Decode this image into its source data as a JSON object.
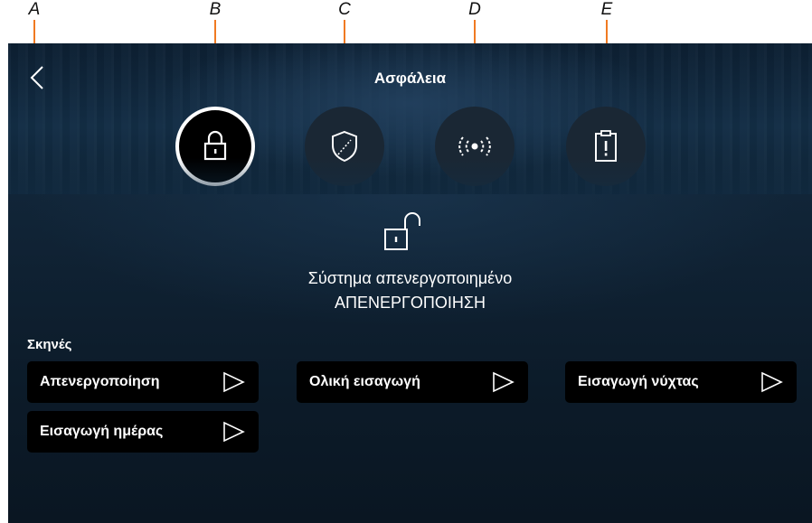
{
  "callouts": [
    "A",
    "B",
    "C",
    "D",
    "E"
  ],
  "header": {
    "title": "Ασφάλεια"
  },
  "tabs": [
    {
      "name": "lock",
      "icon": "padlock-icon",
      "active": true
    },
    {
      "name": "zones",
      "icon": "shield-icon",
      "active": false
    },
    {
      "name": "sensors",
      "icon": "signal-icon",
      "active": false
    },
    {
      "name": "events",
      "icon": "clipboard-alert-icon",
      "active": false
    }
  ],
  "status": {
    "icon": "unlocked-padlock-icon",
    "line1": "Σύστημα απενεργοποιημένο",
    "line2": "ΑΠΕΝΕΡΓΟΠΟΙΗΣΗ"
  },
  "scenes": {
    "label": "Σκηνές",
    "items": [
      {
        "label": "Απενεργοποίηση",
        "icon": "play-icon"
      },
      {
        "label": "Ολική εισαγωγή",
        "icon": "play-icon"
      },
      {
        "label": "Εισαγωγή νύχτας",
        "icon": "play-icon"
      },
      {
        "label": "Εισαγωγή ημέρας",
        "icon": "play-icon"
      }
    ]
  },
  "colors": {
    "callout_line": "#f07a22",
    "background": "#0d1c2b",
    "button": "#000000",
    "text": "#ffffff"
  }
}
